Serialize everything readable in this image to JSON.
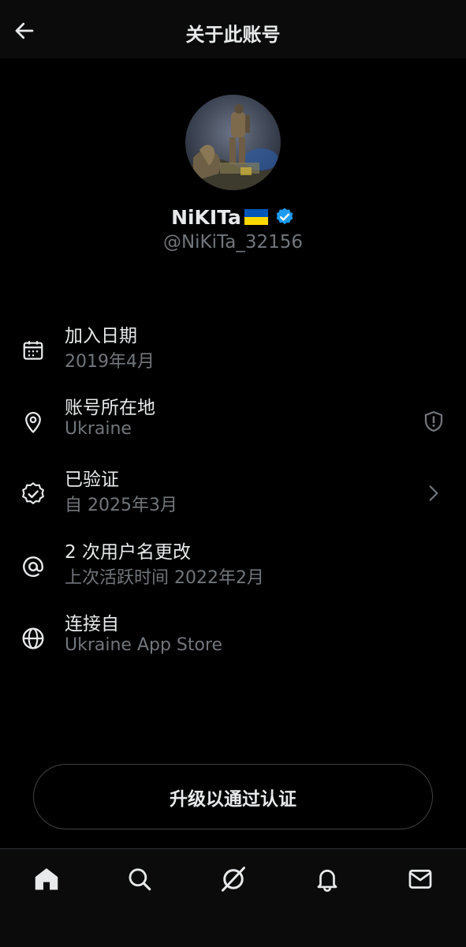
{
  "header": {
    "title": "关于此账号"
  },
  "profile": {
    "display_name": "NiKITa",
    "handle": "@NiKiTa_32156",
    "verified": true
  },
  "info": {
    "joined_label": "加入日期",
    "joined_value": "2019年4月",
    "location_label": "账号所在地",
    "location_value": "Ukraine",
    "verified_label": "已验证",
    "verified_value": "自 2025年3月",
    "username_label": "2 次用户名更改",
    "username_value": "上次活跃时间 2022年2月",
    "connected_label": "连接自",
    "connected_value": "Ukraine App Store"
  },
  "actions": {
    "upgrade_label": "升级以通过认证"
  },
  "nav": {
    "items": [
      "home-icon",
      "search-icon",
      "grok-icon",
      "notifications-icon",
      "messages-icon"
    ]
  },
  "colors": {
    "background": "#000000",
    "primary_text": "#e7e9ea",
    "secondary_text": "#71767b",
    "verified_blue": "#1d9bf0",
    "flag_blue": "#0057b7",
    "flag_yellow": "#ffd700"
  }
}
